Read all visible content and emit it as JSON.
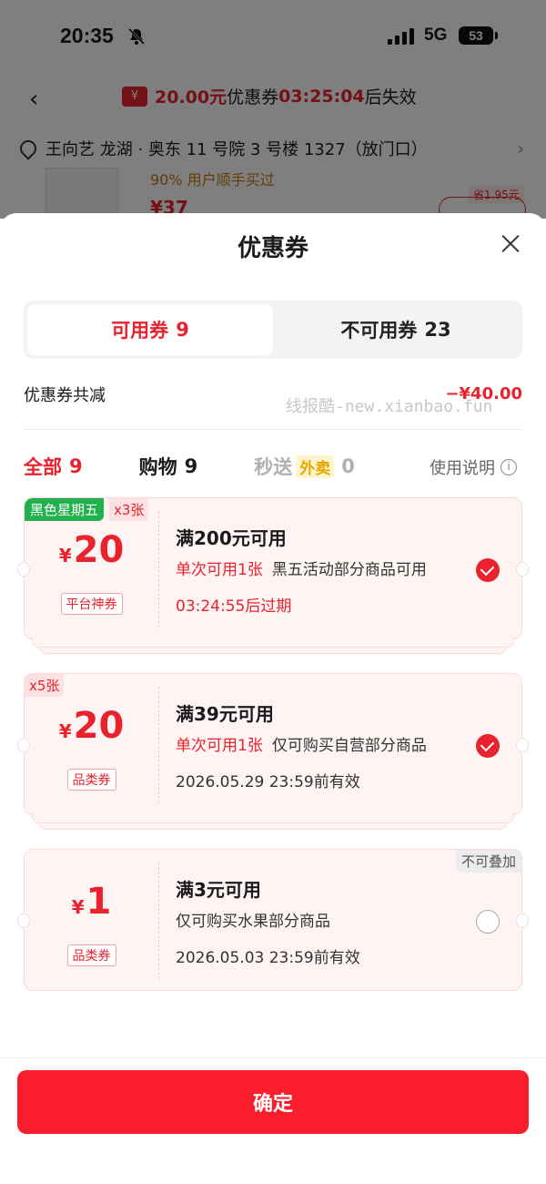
{
  "status_bar": {
    "time": "20:35",
    "network": "5G",
    "battery": "53"
  },
  "header": {
    "amount": "20.00元",
    "text1": "优惠券",
    "countdown": "03:25:04",
    "text2": "后失效"
  },
  "address": {
    "text": "王向艺  龙湖 · 奥东 11 号院 3 号楼 1327（放门口）"
  },
  "product_peek": {
    "text": "90% 用户顺手买过",
    "price": "¥37",
    "save": "省1.95元"
  },
  "sheet": {
    "title": "优惠券",
    "tabs": [
      {
        "label": "可用券",
        "count": "9"
      },
      {
        "label": "不可用券",
        "count": "23"
      }
    ],
    "total_label": "优惠券共减",
    "total_value": "−¥40.00",
    "watermark": "线报酷-new.xianbao.fun",
    "filters": [
      {
        "label": "全部",
        "count": "9"
      },
      {
        "label": "购物",
        "count": "9"
      },
      {
        "label": "秒送",
        "tag": "外卖",
        "count": "0"
      }
    ],
    "help": "使用说明",
    "coupons": [
      {
        "badge": "黑色星期五",
        "qty": "x3张",
        "currency": "¥",
        "value": "20",
        "type": "平台神券",
        "condition": "满200元可用",
        "limit": "单次可用1张",
        "desc": "黑五活动部分商品可用",
        "expiry": "03:24:55后过期",
        "checked": true
      },
      {
        "qty": "x5张",
        "currency": "¥",
        "value": "20",
        "type": "品类券",
        "condition": "满39元可用",
        "limit": "单次可用1张",
        "desc": "仅可购买自营部分商品",
        "expiry": "2026.05.29 23:59前有效",
        "checked": true
      },
      {
        "nostack": "不可叠加",
        "currency": "¥",
        "value": "1",
        "type": "品类券",
        "condition": "满3元可用",
        "desc": "仅可购买水果部分商品",
        "expiry": "2026.05.03 23:59前有效",
        "checked": false
      }
    ],
    "confirm": "确定"
  }
}
